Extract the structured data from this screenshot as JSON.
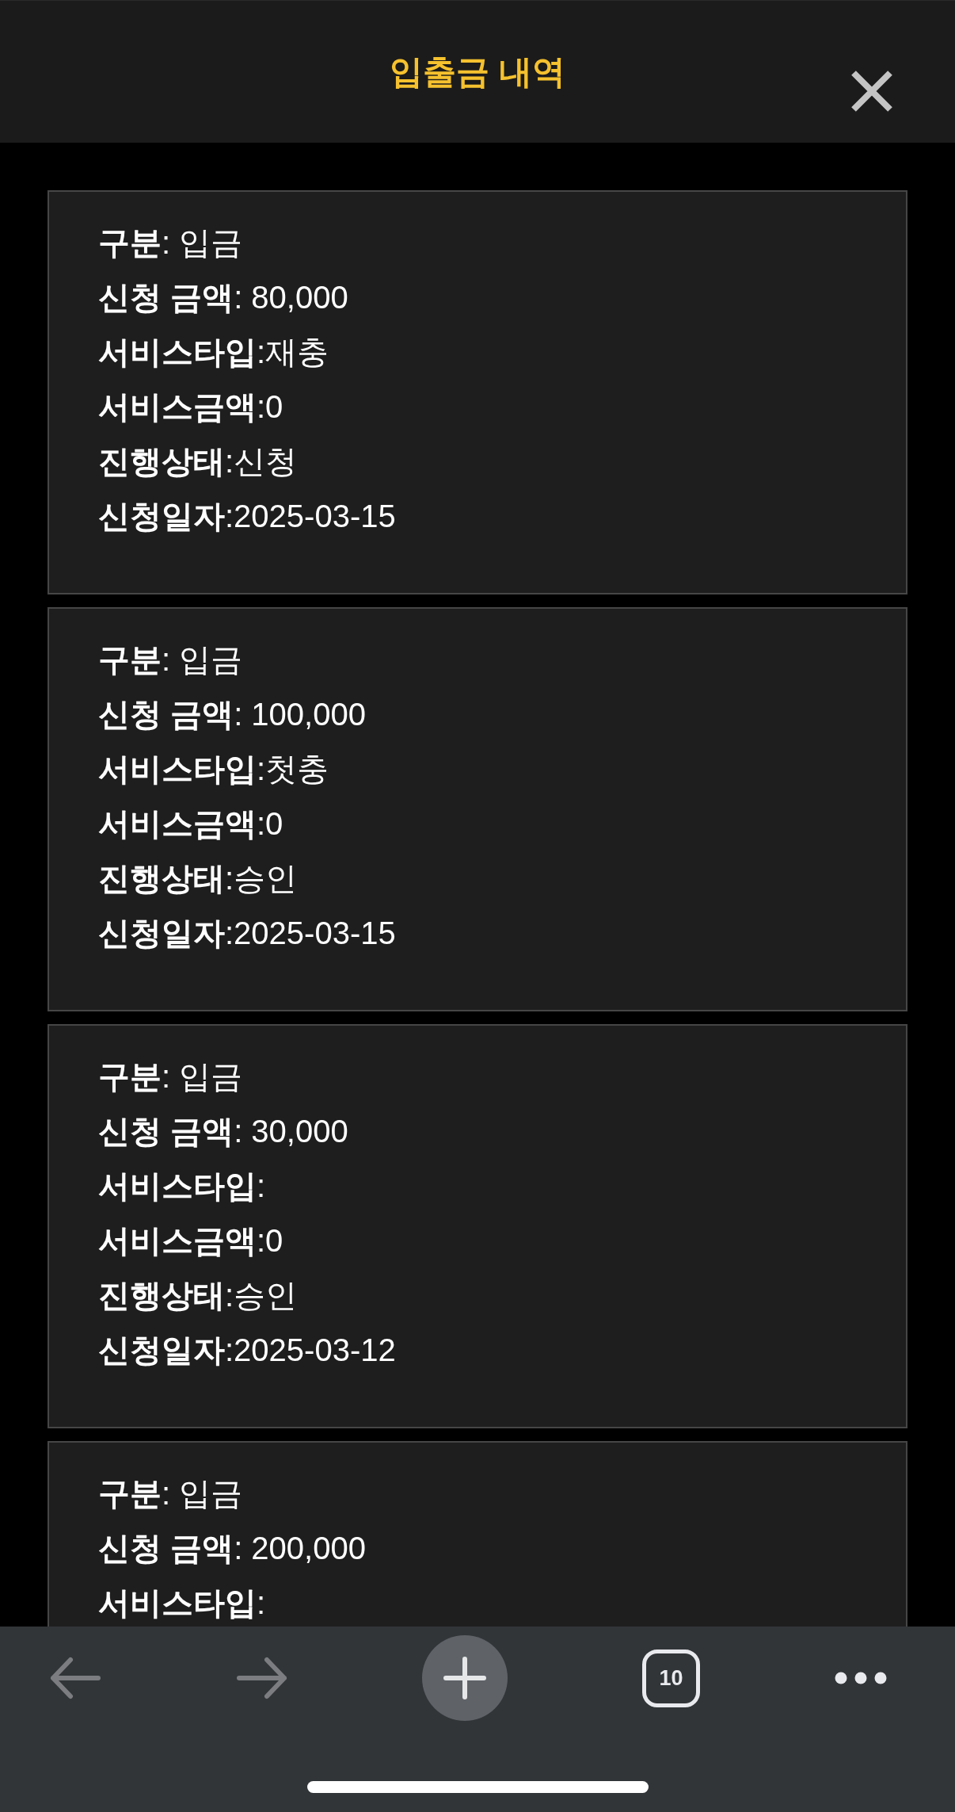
{
  "header": {
    "title": "입출금 내역"
  },
  "records": [
    {
      "fields": [
        "**구분**: 입금",
        "**신청 금액**: 80,000",
        "**서비스타입**:재충",
        "**서비스금액**:0",
        "**진행상태**:신청",
        "**신청일자**:2025-03-15"
      ]
    },
    {
      "fields": [
        "**구분**: 입금",
        "**신청 금액**: 100,000",
        "**서비스타입**:첫충",
        "**서비스금액**:0",
        "**진행상태**:승인",
        "**신청일자**:2025-03-15"
      ]
    },
    {
      "fields": [
        "**구분**: 입금",
        "**신청 금액**: 30,000",
        "**서비스타입**:",
        "**서비스금액**:0",
        "**진행상태**:승인",
        "**신청일자**:2025-03-12"
      ]
    },
    {
      "fields": [
        "**구분**: 입금",
        "**신청 금액**: 200,000",
        "**서비스타입**:"
      ]
    }
  ],
  "toolbar": {
    "back": {
      "disabled": true
    },
    "forward": {
      "disabled": true
    },
    "tab_count": "10"
  }
}
